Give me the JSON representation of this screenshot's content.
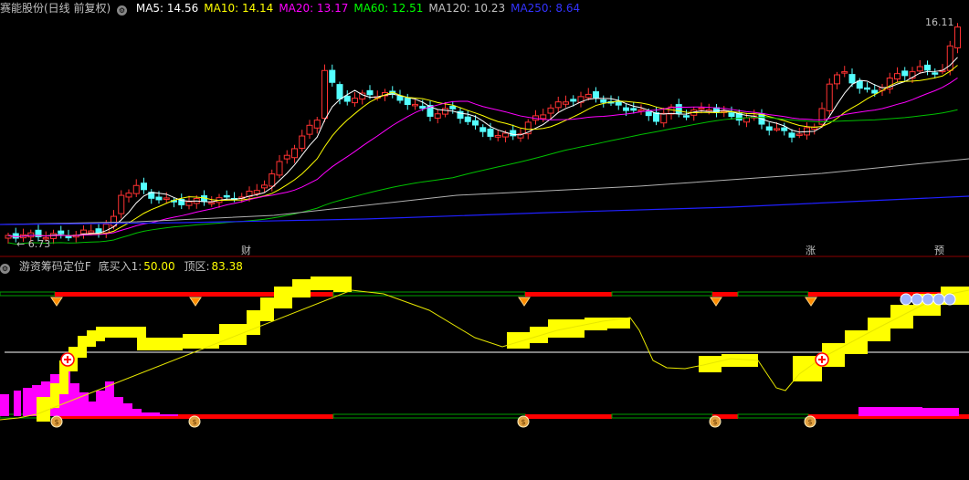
{
  "main": {
    "stock_title": "赛能股份(日线 前复权)",
    "ma": [
      {
        "label": "MA5:",
        "value": "14.56",
        "color": "#ffffff"
      },
      {
        "label": "MA10:",
        "value": "14.14",
        "color": "#ffff00"
      },
      {
        "label": "MA20:",
        "value": "13.17",
        "color": "#ff00ff"
      },
      {
        "label": "MA60:",
        "value": "12.51",
        "color": "#00ff00"
      },
      {
        "label": "MA120:",
        "value": "10.23",
        "color": "#c0c0c0"
      },
      {
        "label": "MA250:",
        "value": "8.64",
        "color": "#3333ff"
      }
    ],
    "high_label": "16.11",
    "low_label": "6.73",
    "event_tags": [
      {
        "text": "财",
        "color": "#00bfff"
      },
      {
        "text": "涨",
        "color": "#ff4040"
      },
      {
        "text": "预",
        "color": "#ff8000"
      }
    ]
  },
  "indicator": {
    "title": "游资筹码定位F",
    "param_label": "底买入1:",
    "param_value": "50.00",
    "zone_label": "顶区:",
    "zone_value": "83.38"
  },
  "colors": {
    "up": "#ff3232",
    "down": "#54ffff",
    "yellow": "#ffff00",
    "magenta": "#ff00ff",
    "red_bar": "#ff0000",
    "green_bar": "#00a000"
  },
  "icons": {
    "settings": "gear-icon",
    "top_marker": "diamond-icon",
    "bottom_marker": "money-bag-icon",
    "buy_marker": "plus-circle-icon",
    "top_zone_face": "face-icon"
  }
}
